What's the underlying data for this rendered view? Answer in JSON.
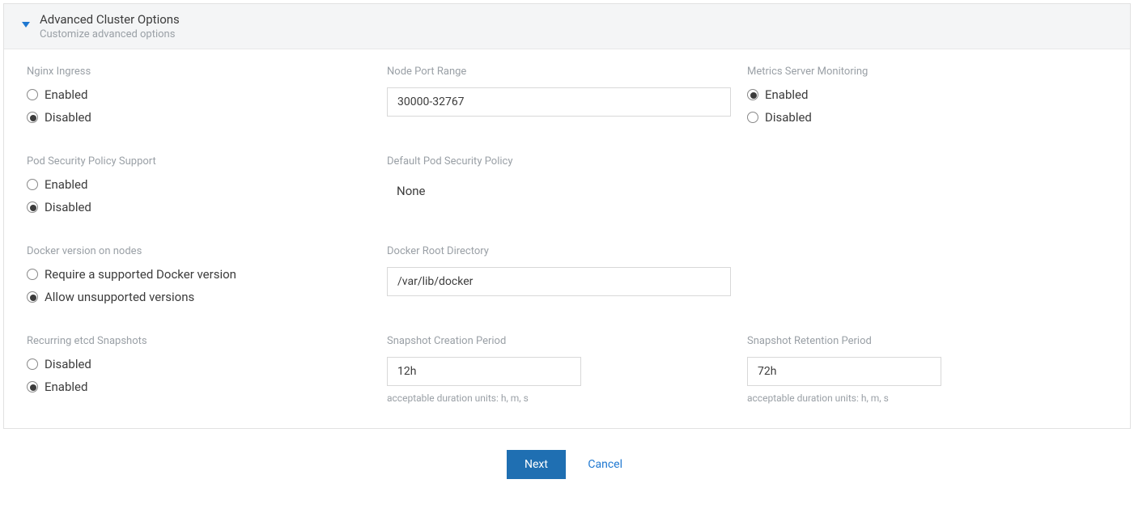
{
  "panel": {
    "title": "Advanced Cluster Options",
    "subtitle": "Customize advanced options"
  },
  "nginx_ingress": {
    "label": "Nginx Ingress",
    "options": {
      "enabled": "Enabled",
      "disabled": "Disabled"
    },
    "selected": "disabled"
  },
  "node_port_range": {
    "label": "Node Port Range",
    "value": "30000-32767"
  },
  "metrics_server": {
    "label": "Metrics Server Monitoring",
    "options": {
      "enabled": "Enabled",
      "disabled": "Disabled"
    },
    "selected": "enabled"
  },
  "pod_security_support": {
    "label": "Pod Security Policy Support",
    "options": {
      "enabled": "Enabled",
      "disabled": "Disabled"
    },
    "selected": "disabled"
  },
  "default_pod_security_policy": {
    "label": "Default Pod Security Policy",
    "value": "None"
  },
  "docker_version": {
    "label": "Docker version on nodes",
    "options": {
      "require": "Require a supported Docker version",
      "allow": "Allow unsupported versions"
    },
    "selected": "allow"
  },
  "docker_root_dir": {
    "label": "Docker Root Directory",
    "value": "/var/lib/docker"
  },
  "recurring_snapshots": {
    "label": "Recurring etcd Snapshots",
    "options": {
      "disabled": "Disabled",
      "enabled": "Enabled"
    },
    "selected": "enabled"
  },
  "snapshot_creation": {
    "label": "Snapshot Creation Period",
    "value": "12h",
    "hint": "acceptable duration units: h, m, s"
  },
  "snapshot_retention": {
    "label": "Snapshot Retention Period",
    "value": "72h",
    "hint": "acceptable duration units: h, m, s"
  },
  "footer": {
    "next": "Next",
    "cancel": "Cancel"
  }
}
